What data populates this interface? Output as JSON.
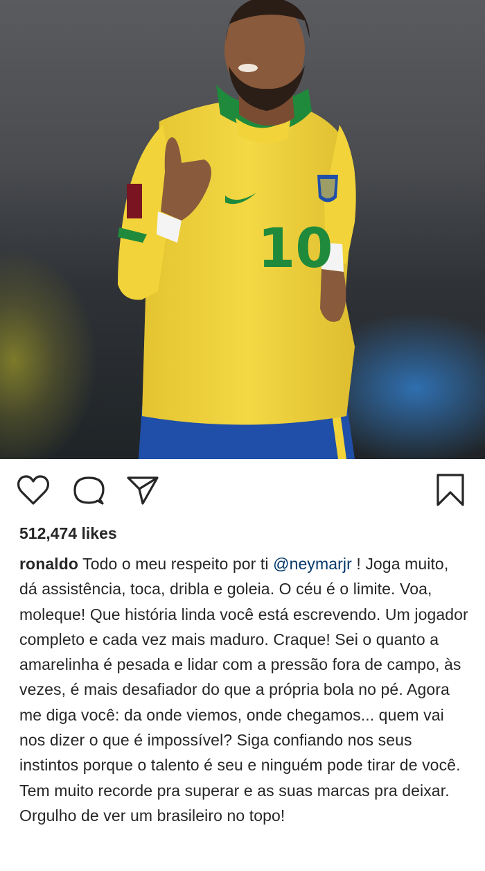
{
  "post": {
    "image_alt": "Player in yellow number 10 jersey celebrating"
  },
  "actions": {
    "like_icon": "heart-icon",
    "comment_icon": "comment-bubble-icon",
    "share_icon": "paper-plane-icon",
    "save_icon": "bookmark-icon"
  },
  "likes_text": "512,474 likes",
  "caption": {
    "username": "ronaldo",
    "text_before_mention": " Todo o meu respeito por ti ",
    "mention": "@neymarjr",
    "text_after_mention": " ! Joga muito, dá assistência, toca, dribla e goleia. O céu é o limite. Voa, moleque! Que história linda você está escrevendo. Um jogador completo e cada vez mais maduro. Craque! Sei o quanto a amarelinha é pesada e lidar com a pressão fora de campo, às vezes, é mais desafiador do que a própria bola no pé. Agora me diga você: da onde viemos, onde chegamos... quem vai nos dizer o que é impossível? Siga confiando nos seus instintos porque o talento é seu e ninguém pode tirar de você. Tem muito recorde pra superar e as suas marcas pra deixar. Orgulho de ver um brasileiro no topo!"
  },
  "colors": {
    "text": "#262626",
    "mention": "#00376b",
    "jersey_yellow": "#f2d43a",
    "jersey_green": "#1f8a3c",
    "shorts_blue": "#1f4fa8"
  }
}
